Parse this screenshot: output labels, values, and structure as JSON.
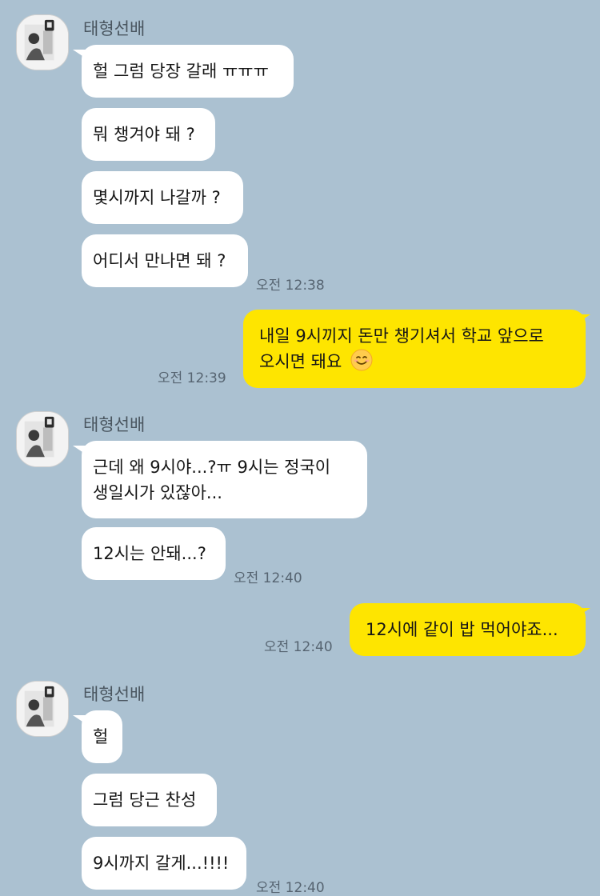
{
  "chat": {
    "sender_name": "태형선배",
    "groups": [
      {
        "sender": "태형선배",
        "messages": [
          "헐 그럼 당장 갈래 ㅠㅠㅠ",
          "뭐 챙겨야 돼 ?",
          "몇시까지 나갈까 ?",
          "어디서 만나면 돼 ?"
        ],
        "time": "오전 12:38"
      },
      {
        "mine": true,
        "messages": [
          [
            "내일 9시끼지 돈만 챙기셔서 학교 앞으로",
            "오시면 돼요"
          ]
        ],
        "emoji": "smiling-face-icon",
        "time": "오전 12:39"
      },
      {
        "sender": "태형선배",
        "messages": [
          [
            "근데 왜 9시야...?ㅠ 9시는 정국이",
            "생일시가 있잖아..."
          ],
          "12시는 안돼...?"
        ],
        "time": "오전 12:40"
      },
      {
        "mine": true,
        "messages": [
          "12시에 같이 밥 먹어야죠..."
        ],
        "time": "오전 12:40"
      },
      {
        "sender": "태형선배",
        "messages": [
          "헐",
          "그럼 당근 찬성",
          "9시까지 갈게...!!!!"
        ],
        "time": "오전 12:40"
      }
    ]
  },
  "colors": {
    "background": "#abc1d1",
    "incoming_bubble": "#ffffff",
    "outgoing_bubble": "#fee500"
  }
}
